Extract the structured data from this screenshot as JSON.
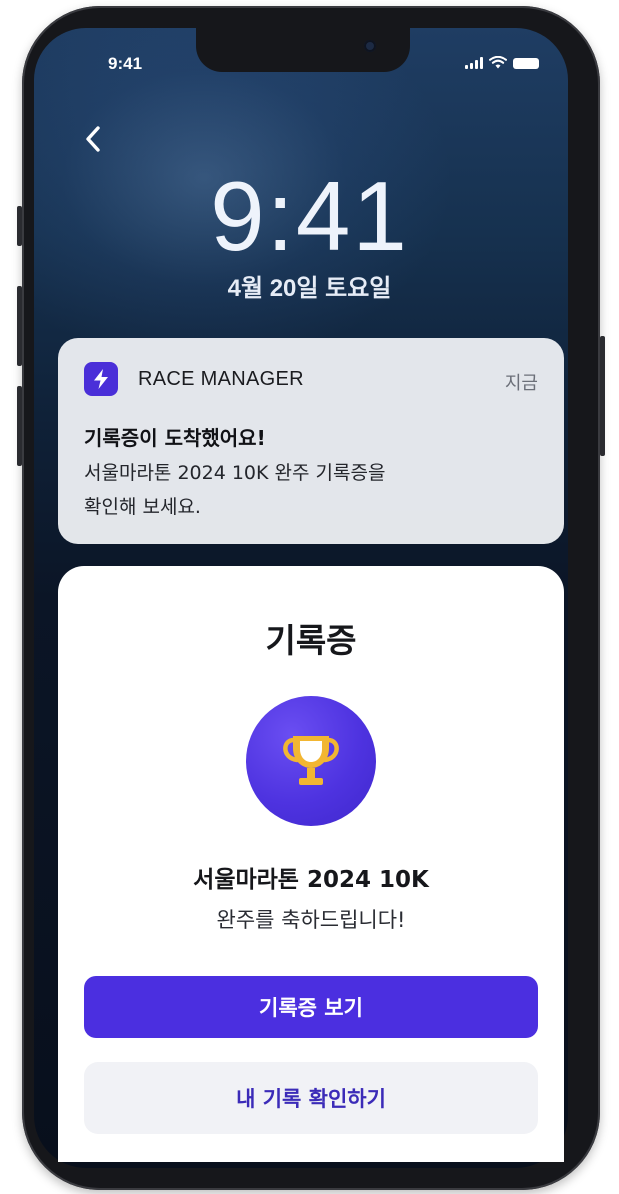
{
  "status_bar": {
    "time": "9:41"
  },
  "lock_screen": {
    "time": "9:41",
    "date": "4월 20일 토요일"
  },
  "notification": {
    "app_name": "RACE MANAGER",
    "time": "지금",
    "title": "기록증이 도착했어요!",
    "body_line1": "서울마라톤 2024 10K 완주 기록증을",
    "body_line2": "확인해 보세요."
  },
  "card": {
    "title": "기록증",
    "race_name": "서울마라톤 2024 10K",
    "congrats": "완주를 축하드립니다!",
    "primary_button": "기록증 보기",
    "secondary_button": "내 기록 확인하기"
  },
  "colors": {
    "accent": "#4b2fe0",
    "trophy": "#f2b632",
    "notification_bg": "#eceef3"
  },
  "icons": {
    "back": "chevron-left-icon",
    "app": "lightning-bolt-icon",
    "badge": "trophy-icon"
  }
}
